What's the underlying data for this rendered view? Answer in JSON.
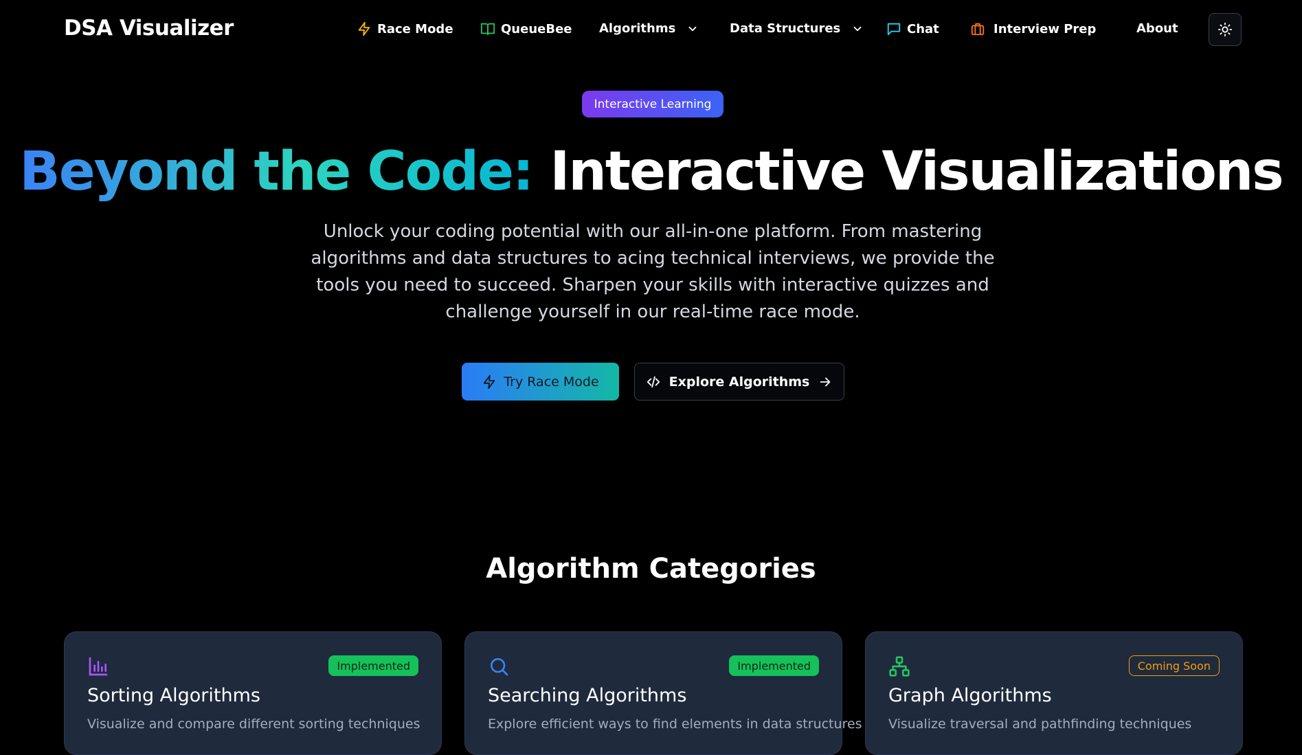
{
  "nav": {
    "brand": "DSA Visualizer",
    "items": [
      {
        "label": "Race Mode",
        "icon": "lightning-icon",
        "color": "#f5b800"
      },
      {
        "label": "QueueBee",
        "icon": "book-icon",
        "color": "#22c55e"
      },
      {
        "label": "Algorithms",
        "icon": "chevron-down-icon"
      },
      {
        "label": "Data Structures",
        "icon": "chevron-down-icon"
      },
      {
        "label": "Chat",
        "icon": "chat-icon",
        "color": "#22d3ee"
      },
      {
        "label": "Interview Prep",
        "icon": "briefcase-icon",
        "color": "#f97316"
      },
      {
        "label": "About"
      }
    ],
    "theme_toggle_icon": "sun-icon"
  },
  "hero": {
    "badge": "Interactive Learning",
    "headline_gradient": "Beyond the Code:",
    "headline_plain": "Interactive Visualizations",
    "subtitle": "Unlock your coding potential with our all-in-one platform. From mastering algorithms and data structures to acing technical interviews, we provide the tools you need to succeed. Sharpen your skills with interactive quizzes and challenge yourself in our real-time race mode.",
    "primary_button": "Try Race Mode",
    "secondary_button": "Explore Algorithms"
  },
  "categories": {
    "title": "Algorithm Categories",
    "cards": [
      {
        "title": "Sorting Algorithms",
        "description": "Visualize and compare different sorting techniques",
        "status": "Implemented",
        "icon": "bar-chart-icon",
        "icon_color": "#a855f7"
      },
      {
        "title": "Searching Algorithms",
        "description": "Explore efficient ways to find elements in data structures",
        "status": "Implemented",
        "icon": "search-icon",
        "icon_color": "#3b82f6"
      },
      {
        "title": "Graph Algorithms",
        "description": "Visualize traversal and pathfinding techniques",
        "status": "Coming Soon",
        "icon": "network-icon",
        "icon_color": "#22c55e"
      }
    ]
  }
}
